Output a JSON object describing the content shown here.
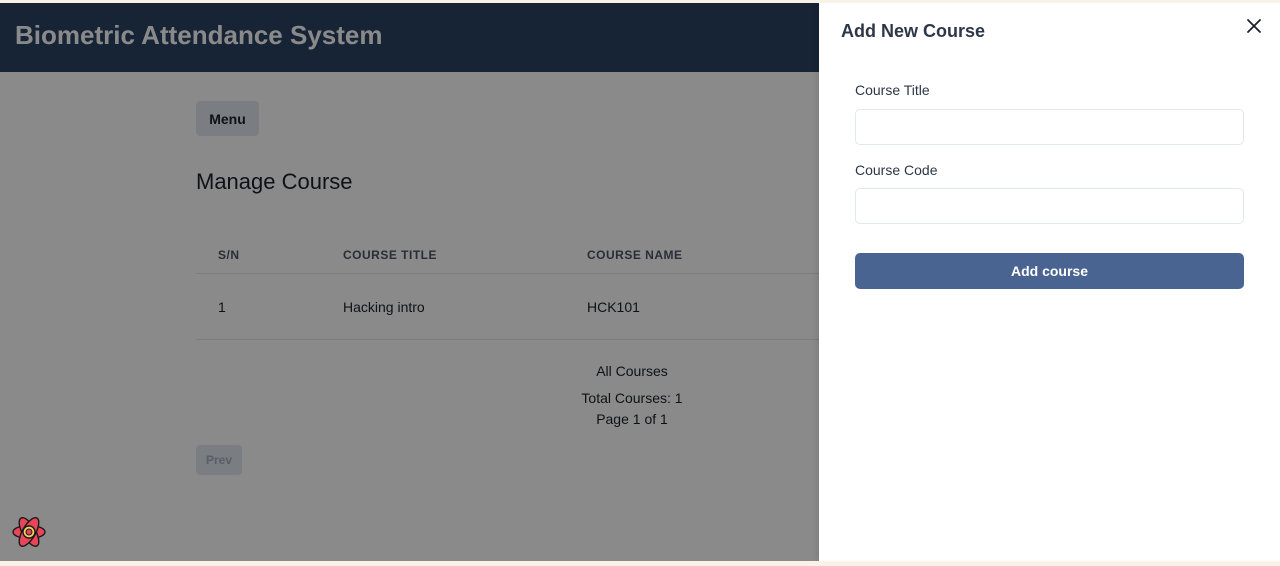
{
  "app": {
    "title": "Biometric Attendance System"
  },
  "toolbar": {
    "menu_label": "Menu"
  },
  "main": {
    "heading": "Manage Course",
    "table": {
      "headers": [
        "S/N",
        "COURSE TITLE",
        "COURSE NAME"
      ],
      "rows": [
        [
          "1",
          "Hacking intro",
          "HCK101"
        ]
      ]
    },
    "caption": "All Courses",
    "total": "Total Courses: 1",
    "page": "Page 1 of 1",
    "prev_label": "Prev"
  },
  "drawer": {
    "title": "Add New Course",
    "fields": [
      {
        "label": "Course Title",
        "value": "",
        "placeholder": ""
      },
      {
        "label": "Course Code",
        "value": "",
        "placeholder": ""
      }
    ],
    "submit_label": "Add course"
  },
  "icons": {
    "close": "close-icon",
    "logo": "react-logo-icon"
  },
  "colors": {
    "header": "#2a4365",
    "submit": "#4a6491",
    "overlay": "rgba(0,0,0,0.46)"
  }
}
